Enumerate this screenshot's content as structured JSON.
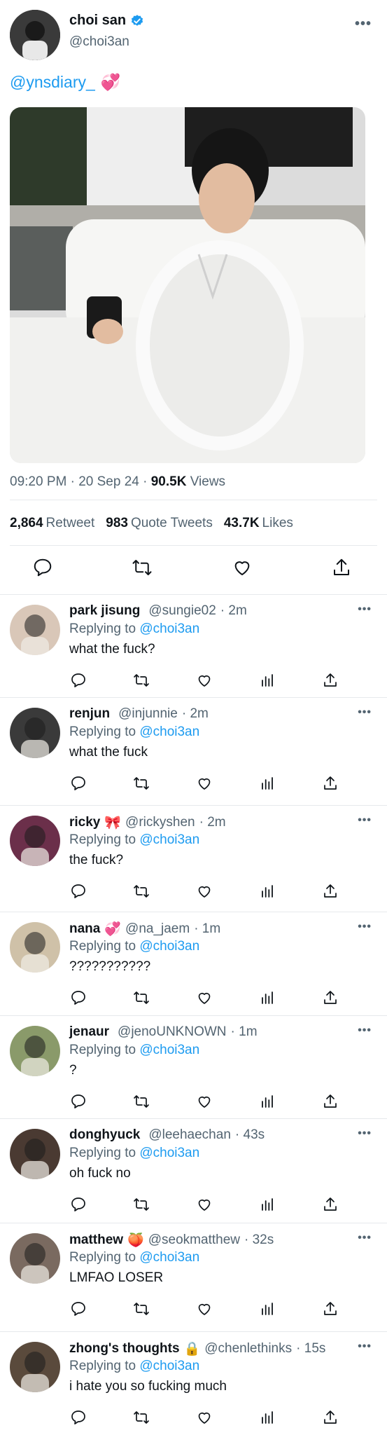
{
  "main": {
    "author_name": "choi san",
    "author_handle": "@choi3an",
    "text": "@ynsdiary_",
    "text_emoji": "💞",
    "time": "09:20 PM · 20 Sep 24 · ",
    "views_count": "90.5K",
    "views_label": " Views",
    "retweets_count": "2,864",
    "retweets_label": "Retweet",
    "quotes_count": "983",
    "quotes_label": "Quote Tweets",
    "likes_count": "43.7K",
    "likes_label": "Likes"
  },
  "replies": [
    {
      "name": "park jisung",
      "badge": "",
      "handle": "@sungie02",
      "time": "· 2m",
      "replying_prefix": "Replying to",
      "replying_to": "@choi3an",
      "text": "what the fuck?",
      "avatar_color": "#d9c7b8"
    },
    {
      "name": "renjun",
      "badge": "",
      "handle": "@injunnie",
      "time": "· 2m",
      "replying_prefix": "Replying to",
      "replying_to": "@choi3an",
      "text": "what the fuck",
      "avatar_color": "#3a3a3a"
    },
    {
      "name": "ricky",
      "badge": "🎀",
      "handle": "@rickyshen",
      "time": "· 2m",
      "replying_prefix": "Replying to",
      "replying_to": "@choi3an",
      "text": "the fuck?",
      "avatar_color": "#6b2f4a"
    },
    {
      "name": "nana",
      "badge": "💞",
      "handle": "@na_jaem",
      "time": "· 1m",
      "replying_prefix": "Replying to",
      "replying_to": "@choi3an",
      "text": "???????????",
      "avatar_color": "#cfc1a8"
    },
    {
      "name": "jenaur",
      "badge": "",
      "handle": "@jenoUNKNOWN",
      "time": "· 1m",
      "replying_prefix": "Replying to",
      "replying_to": "@choi3an",
      "text": "?",
      "avatar_color": "#8a9a6a"
    },
    {
      "name": "donghyuck",
      "badge": "",
      "handle": "@leehaechan",
      "time": "· 43s",
      "replying_prefix": "Replying to",
      "replying_to": "@choi3an",
      "text": "oh fuck no",
      "avatar_color": "#4a3a32"
    },
    {
      "name": "matthew",
      "badge": "🍑",
      "handle": "@seokmatthew",
      "time": "· 32s",
      "replying_prefix": "Replying to",
      "replying_to": "@choi3an",
      "text": "LMFAO LOSER",
      "avatar_color": "#7a6a60"
    },
    {
      "name": "zhong's thoughts",
      "badge": "🔒",
      "handle": "@chenlethinks",
      "time": "· 15s",
      "replying_prefix": "Replying to",
      "replying_to": "@choi3an",
      "text": "i hate you so fucking much",
      "avatar_color": "#5a4a3c"
    }
  ],
  "colors": {
    "link": "#1d9bf0",
    "verified": "#1d9bf0",
    "muted": "#536471"
  }
}
